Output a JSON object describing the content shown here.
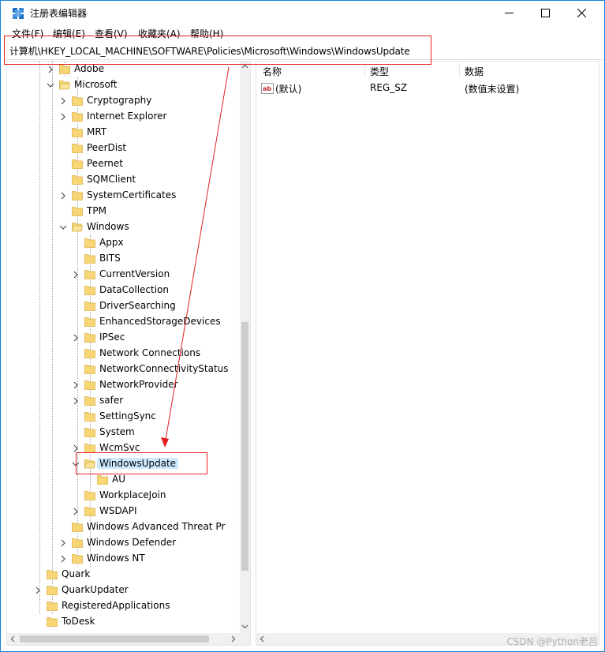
{
  "window": {
    "title": "注册表编辑器",
    "minimize_glyph": "─",
    "maximize_glyph": "☐",
    "close_glyph": "✕"
  },
  "menu": [
    {
      "label": "文件(F)"
    },
    {
      "label": "编辑(E)"
    },
    {
      "label": "查看(V)"
    },
    {
      "label": "收藏夹(A)"
    },
    {
      "label": "帮助(H)"
    }
  ],
  "address": {
    "path": "计算机\\HKEY_LOCAL_MACHINE\\SOFTWARE\\Policies\\Microsoft\\Windows\\WindowsUpdate"
  },
  "tree": {
    "items": [
      {
        "label": "Adobe",
        "state": "collapsed"
      },
      {
        "label": "Microsoft",
        "state": "expanded"
      },
      {
        "label": "Cryptography",
        "state": "collapsed"
      },
      {
        "label": "Internet Explorer",
        "state": "collapsed"
      },
      {
        "label": "MRT",
        "state": "leaf"
      },
      {
        "label": "PeerDist",
        "state": "leaf"
      },
      {
        "label": "Peernet",
        "state": "leaf"
      },
      {
        "label": "SQMClient",
        "state": "leaf"
      },
      {
        "label": "SystemCertificates",
        "state": "collapsed"
      },
      {
        "label": "TPM",
        "state": "leaf"
      },
      {
        "label": "Windows",
        "state": "expanded"
      },
      {
        "label": "Appx",
        "state": "leaf"
      },
      {
        "label": "BITS",
        "state": "leaf"
      },
      {
        "label": "CurrentVersion",
        "state": "collapsed"
      },
      {
        "label": "DataCollection",
        "state": "leaf"
      },
      {
        "label": "DriverSearching",
        "state": "leaf"
      },
      {
        "label": "EnhancedStorageDevices",
        "state": "leaf"
      },
      {
        "label": "IPSec",
        "state": "collapsed"
      },
      {
        "label": "Network Connections",
        "state": "leaf"
      },
      {
        "label": "NetworkConnectivityStatus",
        "state": "leaf"
      },
      {
        "label": "NetworkProvider",
        "state": "collapsed"
      },
      {
        "label": "safer",
        "state": "collapsed"
      },
      {
        "label": "SettingSync",
        "state": "leaf"
      },
      {
        "label": "System",
        "state": "leaf"
      },
      {
        "label": "WcmSvc",
        "state": "collapsed"
      },
      {
        "label": "WindowsUpdate",
        "state": "expanded",
        "selected": true
      },
      {
        "label": "AU",
        "state": "leaf"
      },
      {
        "label": "WorkplaceJoin",
        "state": "leaf"
      },
      {
        "label": "WSDAPI",
        "state": "collapsed"
      },
      {
        "label": "Windows Advanced Threat Pr",
        "state": "leaf"
      },
      {
        "label": "Windows Defender",
        "state": "collapsed"
      },
      {
        "label": "Windows NT",
        "state": "collapsed"
      },
      {
        "label": "Quark",
        "state": "leaf"
      },
      {
        "label": "QuarkUpdater",
        "state": "collapsed"
      },
      {
        "label": "RegisteredApplications",
        "state": "leaf"
      },
      {
        "label": "ToDesk",
        "state": "leaf"
      }
    ]
  },
  "list": {
    "columns": [
      "名称",
      "类型",
      "数据"
    ],
    "rows": [
      {
        "name": "(默认)",
        "type": "REG_SZ",
        "data": "(数值未设置)",
        "icon": "ab"
      }
    ]
  },
  "watermark": "CSDN @Python老吕",
  "colors": {
    "folder": "#f8d675",
    "selection": "#cce8ff",
    "annotation": "#e02020",
    "window_border": "#1883d7"
  }
}
